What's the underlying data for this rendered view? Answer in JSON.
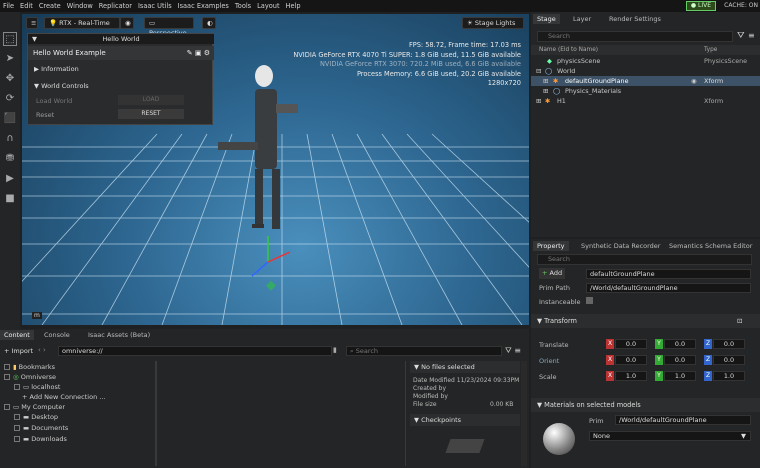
{
  "menu": [
    "File",
    "Edit",
    "Create",
    "Window",
    "Replicator",
    "Isaac Utils",
    "Isaac Examples",
    "Tools",
    "Layout",
    "Help"
  ],
  "live_label": "LIVE",
  "cache_label": "CACHE: ON",
  "viewport": {
    "render_mode": "RTX - Real-Time",
    "camera": "Perspective",
    "stage_lights": "Stage Lights",
    "stats": [
      "FPS: 58.72, Frame time: 17.03 ms",
      "NVIDIA GeForce RTX 4070 Ti SUPER: 1.8 GiB used, 11.5 GiB available",
      "NVIDIA GeForce RTX 3070: 720.2 MiB used, 6.6 GiB available",
      "Process Memory: 6.6 GiB used, 20.2 GiB available",
      "1280x720"
    ],
    "corner_label": "m"
  },
  "hello": {
    "window_title": "Hello World",
    "panel_title": "Hello World Example",
    "information": "Information",
    "world_controls": "World Controls",
    "load_label": "Load World",
    "load_btn": "LOAD",
    "reset_label": "Reset",
    "reset_btn": "RESET"
  },
  "stage": {
    "tabs": [
      "Stage",
      "Layer",
      "Render Settings"
    ],
    "search_placeholder": "Search",
    "col_name": "Name (Eid to Name)",
    "col_type": "Type",
    "rows": [
      {
        "name": "physicsScene",
        "type": "PhysicsScene"
      },
      {
        "name": "World",
        "type": ""
      },
      {
        "name": "defaultGroundPlane",
        "type": "Xform"
      },
      {
        "name": "Physics_Materials",
        "type": ""
      },
      {
        "name": "H1",
        "type": "Xform"
      }
    ]
  },
  "property": {
    "tabs": [
      "Property",
      "Synthetic Data Recorder",
      "Semantics Schema Editor"
    ],
    "search_placeholder": "Search",
    "add_label": "Add",
    "add_value": "defaultGroundPlane",
    "prim_path_label": "Prim Path",
    "prim_path_value": "/World/defaultGroundPlane",
    "instanceable_label": "Instanceable",
    "transform_label": "Transform",
    "translate_label": "Translate",
    "orient_label": "Orient",
    "scale_label": "Scale",
    "translate": [
      "0.0",
      "0.0",
      "0.0"
    ],
    "orient": [
      "0.0",
      "0.0",
      "0.0"
    ],
    "scale": [
      "1.0",
      "1.0",
      "1.0"
    ],
    "materials_label": "Materials on selected models",
    "prim_label": "Prim",
    "prim_value": "/World/defaultGroundPlane",
    "material_value": "None"
  },
  "content": {
    "tabs": [
      "Content",
      "Console",
      "Isaac Assets (Beta)"
    ],
    "import": "Import",
    "path": "omniverse://",
    "search_placeholder": "Search",
    "tree": [
      "Bookmarks",
      "Omniverse",
      "localhost",
      "Add New Connection ...",
      "My Computer",
      "Desktop",
      "Documents",
      "Downloads"
    ],
    "no_files": "No files selected",
    "date_modified": "Date Modified 11/23/2024 09:33PM",
    "created_by": "Created by",
    "modified_by": "Modified by",
    "file_size": "File size",
    "file_size_val": "0.00 KB",
    "checkpoints": "Checkpoints"
  }
}
